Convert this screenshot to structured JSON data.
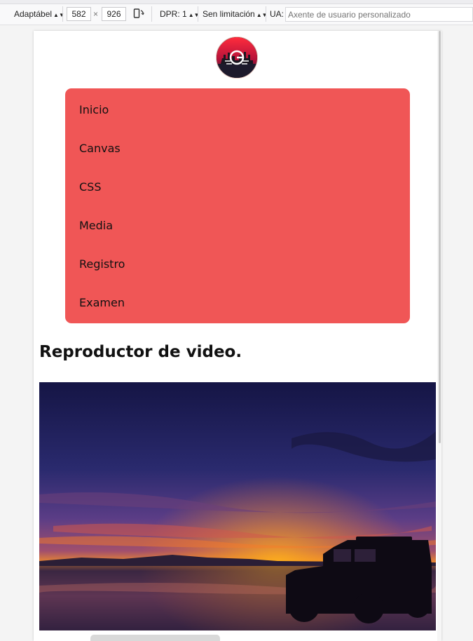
{
  "devtools": {
    "device": "Adaptábel",
    "width": "582",
    "times": "×",
    "height": "926",
    "dpr": "DPR: 1",
    "throttle": "Sen limitación",
    "ua_label": "UA:",
    "ua_placeholder": "Axente de usuario personalizado"
  },
  "page": {
    "nav": [
      "Inicio",
      "Canvas",
      "CSS",
      "Media",
      "Registro",
      "Examen"
    ],
    "heading": "Reproductor de video."
  },
  "colors": {
    "nav_bg": "#f05656",
    "text": "#111111"
  }
}
